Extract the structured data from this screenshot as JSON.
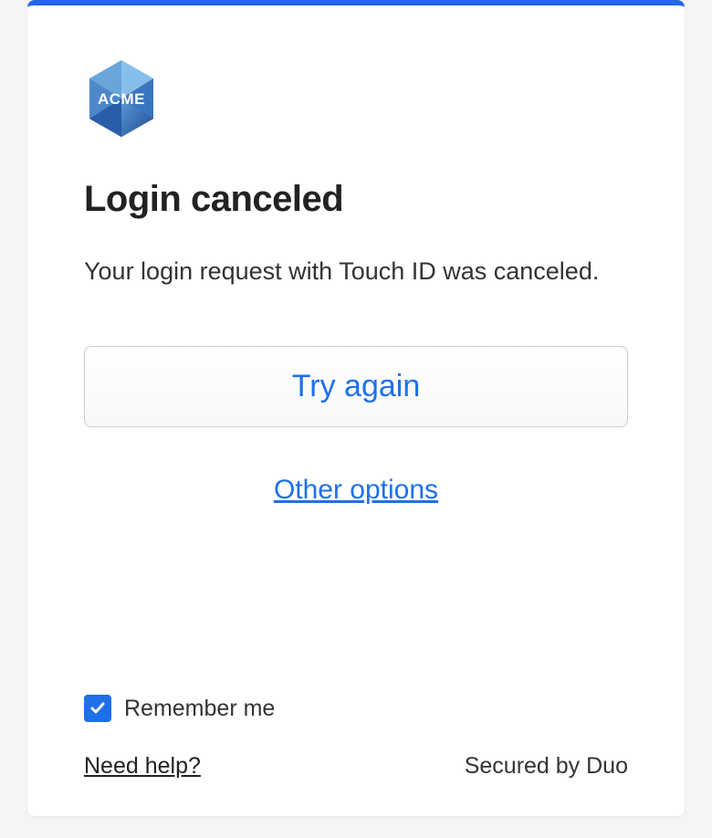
{
  "logo": {
    "text": "ACME"
  },
  "title": "Login canceled",
  "message": "Your login request with Touch ID was canceled.",
  "buttons": {
    "try_again": "Try again",
    "other_options": "Other options"
  },
  "remember": {
    "checked": true,
    "label": "Remember me"
  },
  "footer": {
    "need_help": "Need help?",
    "secured_by": "Secured by Duo"
  },
  "colors": {
    "accent": "#1f6feb",
    "border_top": "#2563eb"
  }
}
